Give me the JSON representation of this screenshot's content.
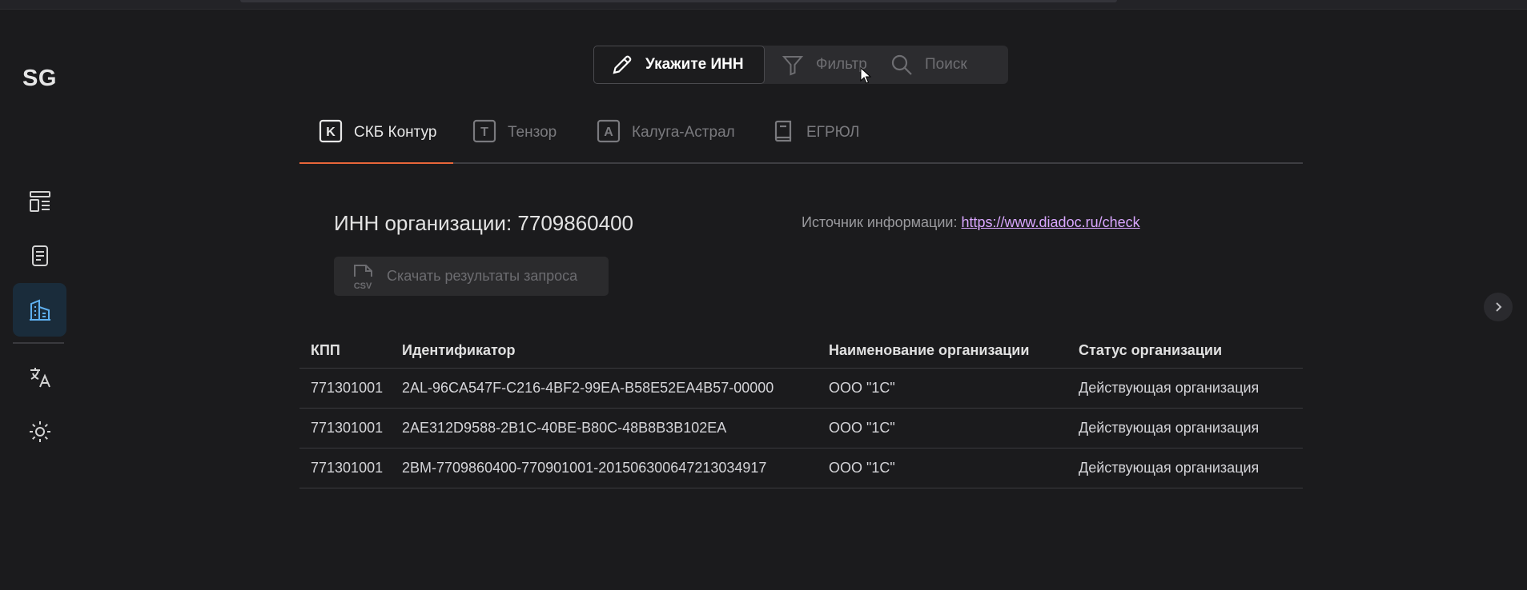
{
  "sidebar": {
    "logo": "SG",
    "items": [
      {
        "icon": "layout-list-icon",
        "active": false
      },
      {
        "icon": "document-icon",
        "active": false
      },
      {
        "icon": "building-icon",
        "active": true
      },
      {
        "icon": "translate-icon",
        "active": false
      },
      {
        "icon": "sun-icon",
        "active": false
      }
    ]
  },
  "toolbar": {
    "inn_label": "Укажите ИНН",
    "filter_label": "Фильтр",
    "search_label": "Поиск"
  },
  "tabs": [
    {
      "label": "СКБ Контур",
      "icon_letter": "K",
      "active": true
    },
    {
      "label": "Тензор",
      "icon_letter": "T",
      "active": false
    },
    {
      "label": "Калуга-Астрал",
      "icon_letter": "A",
      "active": false
    },
    {
      "label": "ЕГРЮЛ",
      "icon": "book-icon",
      "active": false
    }
  ],
  "info": {
    "title": "ИНН организации: 7709860400",
    "source_label": "Источник информации:",
    "source_link": "https://www.diadoc.ru/check",
    "download_label": "Скачать результаты запроса",
    "download_icon_text": "CSV"
  },
  "table": {
    "headers": [
      "КПП",
      "Идентификатор",
      "Наименование организации",
      "Статус организации"
    ],
    "rows": [
      [
        "771301001",
        "2AL-96CA547F-C216-4BF2-99EA-B58E52EA4B57-00000",
        "ООО \"1С\"",
        "Действующая организация"
      ],
      [
        "771301001",
        "2AE312D9588-2B1C-40BE-B80C-48B8B3B102EA",
        "ООО \"1С\"",
        "Действующая организация"
      ],
      [
        "771301001",
        "2BM-7709860400-770901001-201506300647213034917",
        "ООО \"1С\"",
        "Действующая организация"
      ]
    ]
  },
  "colors": {
    "background": "#1b1b1d",
    "accent_tab": "#e8663a",
    "link": "#d9a6ff",
    "active_side": "#1a2c3b",
    "active_icon": "#5fb0f0"
  }
}
